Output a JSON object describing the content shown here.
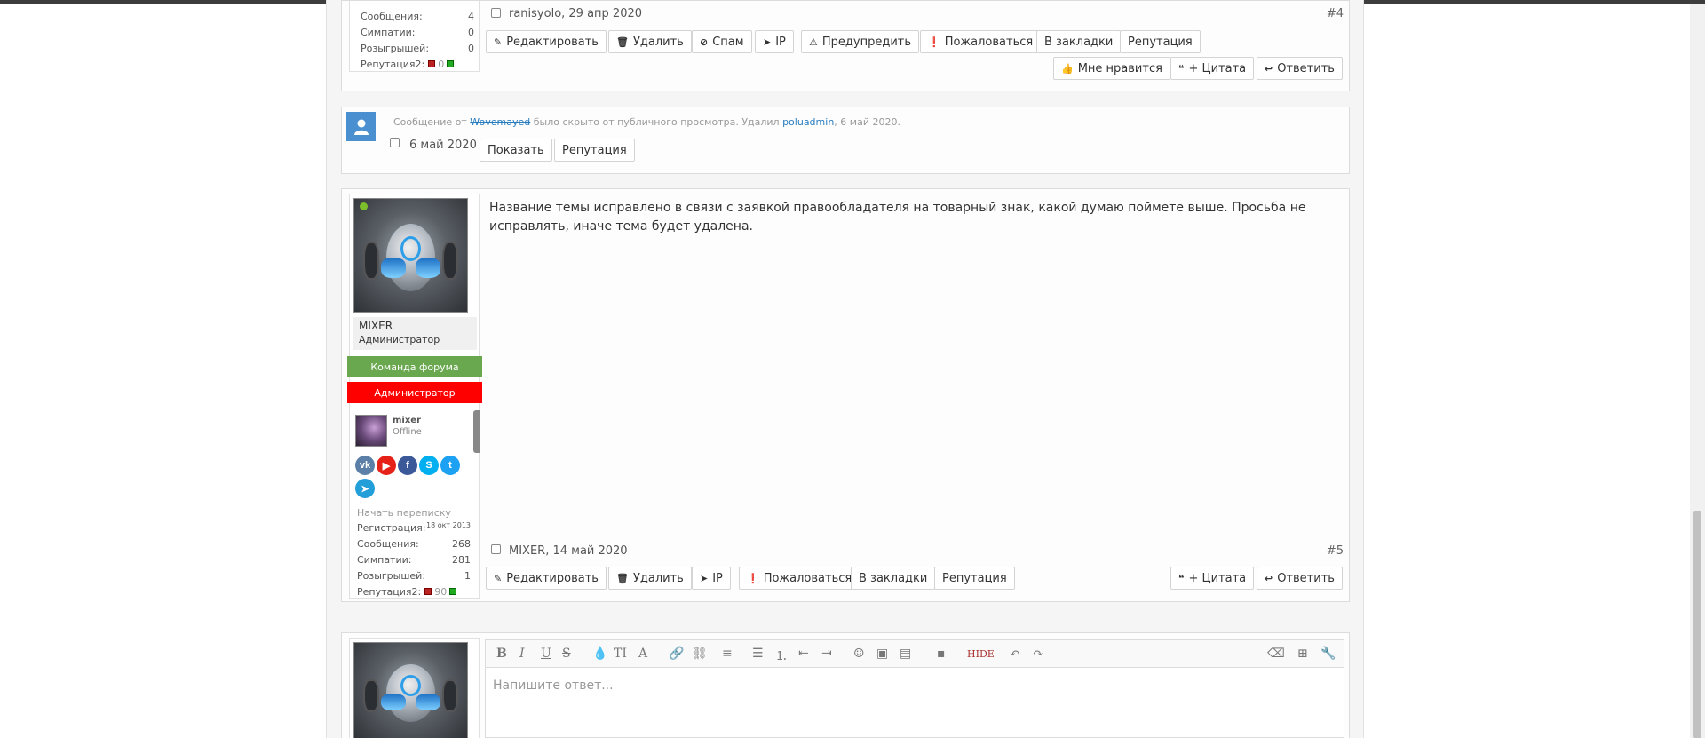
{
  "post4": {
    "stats": [
      {
        "label": "Сообщения:",
        "value": "4"
      },
      {
        "label": "Симпатии:",
        "value": "0"
      },
      {
        "label": "Розыгрышей:",
        "value": "0"
      }
    ],
    "rep_label": "Репутация2:",
    "rep_value": "0",
    "meta": "ranisyolo, 29 апр 2020",
    "num": "#4",
    "actions": [
      "Редактировать",
      "Удалить",
      "Спам",
      "IP",
      "Предупредить",
      "Пожаловаться",
      "В закладки",
      "Репутация"
    ],
    "right_actions": [
      "Мне нравится",
      "+ Цитата",
      "Ответить"
    ]
  },
  "hidden_post": {
    "text_before": "Сообщение от",
    "author": "Wovemayed",
    "text_mid": "было скрыто от публичного просмотра. Удалил",
    "moderator": "poluadmin",
    "text_date": ", 6 май 2020.",
    "date": "6 май 2020",
    "show_button": "Показать",
    "rep_button": "Репутация"
  },
  "post5": {
    "body": "Название темы исправлено в связи с заявкой правообладателя на товарный знак, какой думаю поймете выше. Просьба не исправлять, иначе тема будет удалена.",
    "username": "MIXER",
    "user_title": "Администратор",
    "banner_team": "Команда форума",
    "banner_admin": "Администратор",
    "mini_name": "mixer",
    "mini_status": "Offline",
    "start_conv": "Начать переписку",
    "reg_label": "Регистрация:",
    "reg_value": "18 окт 2013",
    "stats": [
      {
        "label": "Сообщения:",
        "value": "268"
      },
      {
        "label": "Симпатии:",
        "value": "281"
      },
      {
        "label": "Розыгрышей:",
        "value": "1"
      }
    ],
    "rep_label": "Репутация2:",
    "rep_value": "90",
    "meta": "MIXER, 14 май 2020",
    "num": "#5",
    "actions": [
      "Редактировать",
      "Удалить",
      "IP",
      "Пожаловаться",
      "В закладки",
      "Репутация"
    ],
    "right_actions": [
      "+ Цитата",
      "Ответить"
    ],
    "socials": [
      "vk-icon",
      "youtube-icon",
      "facebook-icon",
      "skype-icon",
      "twitter-icon",
      "telegram-icon"
    ]
  },
  "editor": {
    "placeholder": "Напишите ответ...",
    "hide_label": "HIDE"
  },
  "colors": {
    "team_banner": "#6aa84f",
    "admin_banner": "#ff0000",
    "link": "#2a7ec0",
    "online": "#7cbf2a"
  }
}
